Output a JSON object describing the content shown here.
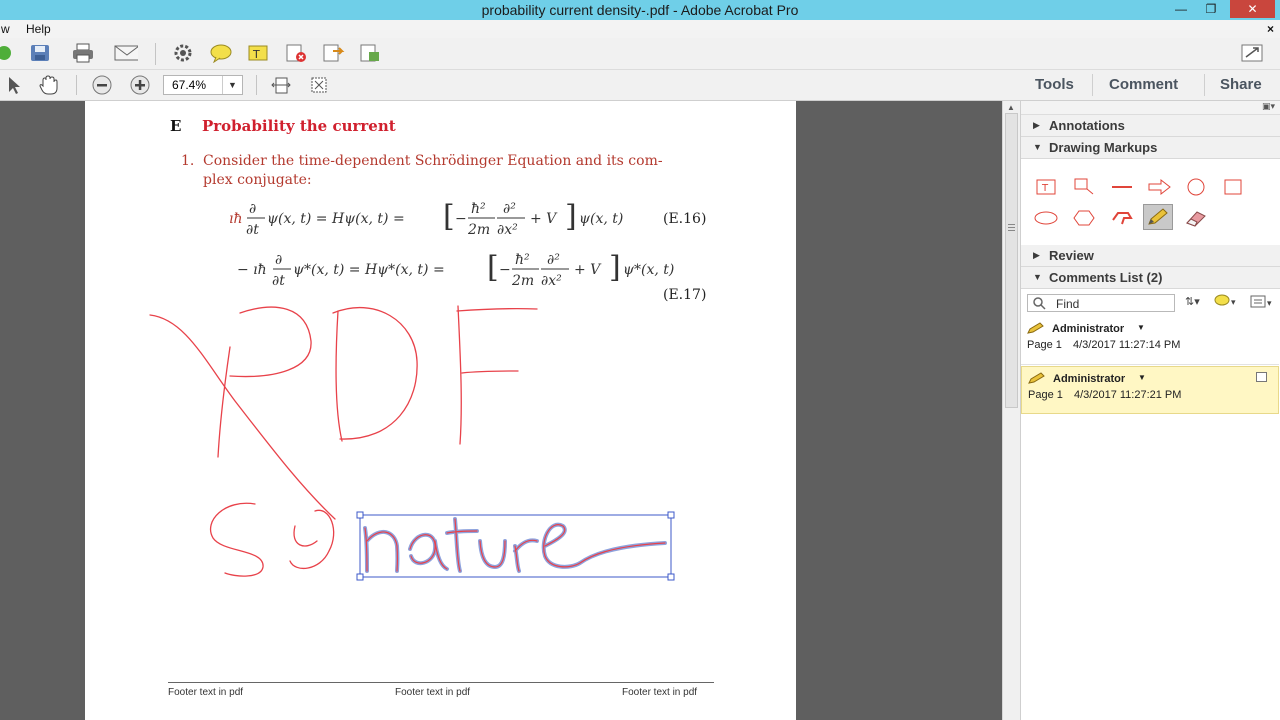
{
  "window": {
    "title": "probability current density-.pdf - Adobe Acrobat Pro",
    "min": "—",
    "restore": "❐",
    "close": "✕"
  },
  "menu": {
    "items": [
      "w",
      "Help"
    ],
    "doc_close": "×"
  },
  "toolbar": {
    "zoom_value": "67.4%",
    "tabs": [
      "Tools",
      "Comment",
      "Share"
    ]
  },
  "document": {
    "section_letter": "E",
    "section_title": "Probability the current",
    "item_number": "1.",
    "item_line1": "Consider the time-dependent Schrödinger Equation and its com-",
    "item_line2": "plex conjugate:",
    "eq16": "iħ ∂ψ(x,t)/∂t = Hψ(x,t) = [ −(ħ²/2m) ∂²/∂x² + V ] ψ(x,t)",
    "eq16_label": "(E.16)",
    "eq17": "−iħ ∂ψ*(x,t)/∂t = Hψ*(x,t) = [ −(ħ²/2m) ∂²/∂x² + V ] ψ*(x,t)",
    "eq17_label": "(E.17)",
    "footer": [
      "Footer  text in pdf",
      "Footer  text in pdf",
      "Footer  text in pdf"
    ]
  },
  "panel": {
    "sections": {
      "annotations": "Annotations",
      "drawing_markups": "Drawing Markups",
      "review": "Review",
      "comments_list": "Comments List (2)"
    },
    "find_placeholder": "Find",
    "comments": [
      {
        "author": "Administrator",
        "page": "Page 1",
        "date": "4/3/2017 11:27:14 PM"
      },
      {
        "author": "Administrator",
        "page": "Page 1",
        "date": "4/3/2017 11:27:21 PM"
      }
    ]
  },
  "colors": {
    "title_bar": "#6fcfe8",
    "section_title_red": "#d0202e",
    "item_text_red": "#b43a2f",
    "ink_red": "#e8424a",
    "markup_red": "#e0453a",
    "selection_blue": "#3c58c8",
    "selected_comment_bg": "#fff7c4"
  }
}
